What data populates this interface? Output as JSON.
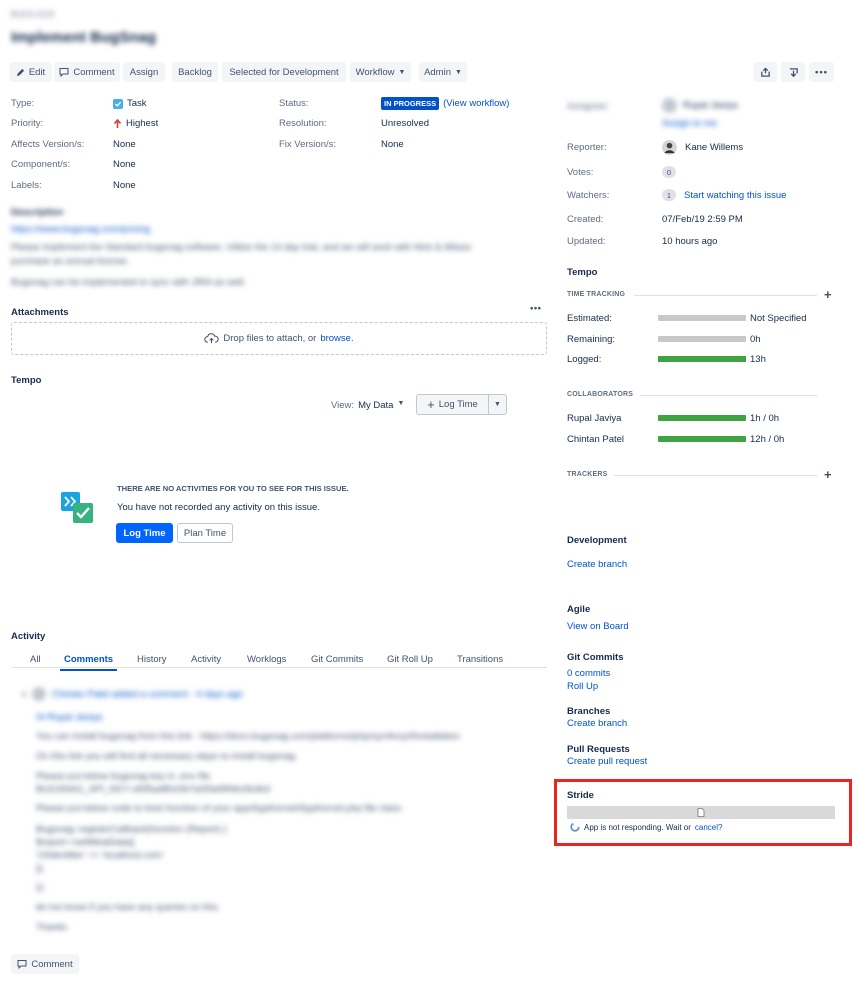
{
  "header": {
    "breadcrumb": "BUGS-3123",
    "title": "Implement BugSnag"
  },
  "toolbar": {
    "edit": "Edit",
    "comment": "Comment",
    "assign": "Assign",
    "backlog": "Backlog",
    "selected_for_development": "Selected for Development",
    "workflow": "Workflow",
    "admin": "Admin"
  },
  "details": {
    "type_label": "Type:",
    "type_value": "Task",
    "priority_label": "Priority:",
    "priority_value": "Highest",
    "affects_label": "Affects Version/s:",
    "affects_value": "None",
    "component_label": "Component/s:",
    "component_value": "None",
    "labels_label": "Labels:",
    "labels_value": "None",
    "status_label": "Status:",
    "status_value": "IN PROGRESS",
    "view_workflow": "(View workflow)",
    "resolution_label": "Resolution:",
    "resolution_value": "Unresolved",
    "fix_label": "Fix Version/s:",
    "fix_value": "None"
  },
  "description": {
    "heading": "Description",
    "link": "https://www.bugsnag.com/pricing",
    "line1": "Please implement the Standard bugsnag software. Utilize the 14 day trial, and we will work with Nick & Allison",
    "line2": "purchase an annual license.",
    "line3": "Bugsnag can be implemented to sync with JIRA as well."
  },
  "attachments": {
    "heading": "Attachments",
    "drop_text": "Drop files to attach, or",
    "browse": "browse."
  },
  "tempo_left": {
    "heading": "Tempo",
    "view_label": "View:",
    "view_value": "My Data",
    "log_time_button": "Log Time",
    "empty_title": "THERE ARE NO ACTIVITIES FOR YOU TO SEE FOR THIS ISSUE.",
    "empty_text": "You have not recorded any activity on this issue.",
    "log_time": "Log Time",
    "plan_time": "Plan Time"
  },
  "activity": {
    "heading": "Activity",
    "tabs": [
      "All",
      "Comments",
      "History",
      "Activity",
      "Worklogs",
      "Git Commits",
      "Git Roll Up",
      "Transitions"
    ],
    "comment_header": "Chintan Patel added a comment - 4 days ago",
    "comment_lines": [
      "Hi Rupal Javiya",
      "You can install bugsnag from this link - https://docs.bugsnag.com/platforms/php/symfony/#installation",
      "On this link you will find all necessary steps to install bugsnag.",
      "Please put below bugsnag key in .env file",
      "BUGSNAG_API_KEY=d0f5ad80c5b7a0f3a5ff46c5b3b3",
      "Please put below code to boot function of your app/AppKernel/AppKernel.php file class.",
      "Bugsnag::registerCallback(function (Report) {",
      "$report->setMetaData([",
      "'UIIdentifier' => 'localhost.com'",
      "]);",
      "});",
      "let me know if you have any queries on this.",
      "Thanks"
    ],
    "comment_button": "Comment"
  },
  "people": {
    "assignee_label": "Assignee:",
    "assignee_value": "Rupal Javiya",
    "assign_to_me": "Assign to me",
    "reporter_label": "Reporter:",
    "reporter_value": "Kane Willems",
    "votes_label": "Votes:",
    "votes_value": "0",
    "watchers_label": "Watchers:",
    "watchers_value": "1",
    "watch_link": "Start watching this issue",
    "created_label": "Created:",
    "created_value": "07/Feb/19 2:59 PM",
    "updated_label": "Updated:",
    "updated_value": "10 hours ago"
  },
  "tempo_right": {
    "heading": "Tempo",
    "time_tracking": "TIME TRACKING",
    "estimated_label": "Estimated:",
    "estimated_value": "Not Specified",
    "remaining_label": "Remaining:",
    "remaining_value": "0h",
    "logged_label": "Logged:",
    "logged_value": "13h",
    "logged_fraction": 1.0,
    "collaborators": "COLLABORATORS",
    "collaborator_rows": [
      {
        "name": "Rupal Javiya",
        "value": "1h / 0h"
      },
      {
        "name": "Chintan Patel",
        "value": "12h / 0h"
      }
    ],
    "trackers": "TRACKERS"
  },
  "development": {
    "heading": "Development",
    "create_branch": "Create branch"
  },
  "agile": {
    "heading": "Agile",
    "view_on_board": "View on Board"
  },
  "git_commits": {
    "heading": "Git Commits",
    "commits": "0 commits",
    "roll_up": "Roll Up"
  },
  "branches": {
    "heading": "Branches",
    "create_branch": "Create branch"
  },
  "pull_requests": {
    "heading": "Pull Requests",
    "create": "Create pull request"
  },
  "stride": {
    "heading": "Stride",
    "message": "App is not responding. Wait or",
    "cancel": "cancel?",
    "highlight_color": "#e8261e"
  }
}
